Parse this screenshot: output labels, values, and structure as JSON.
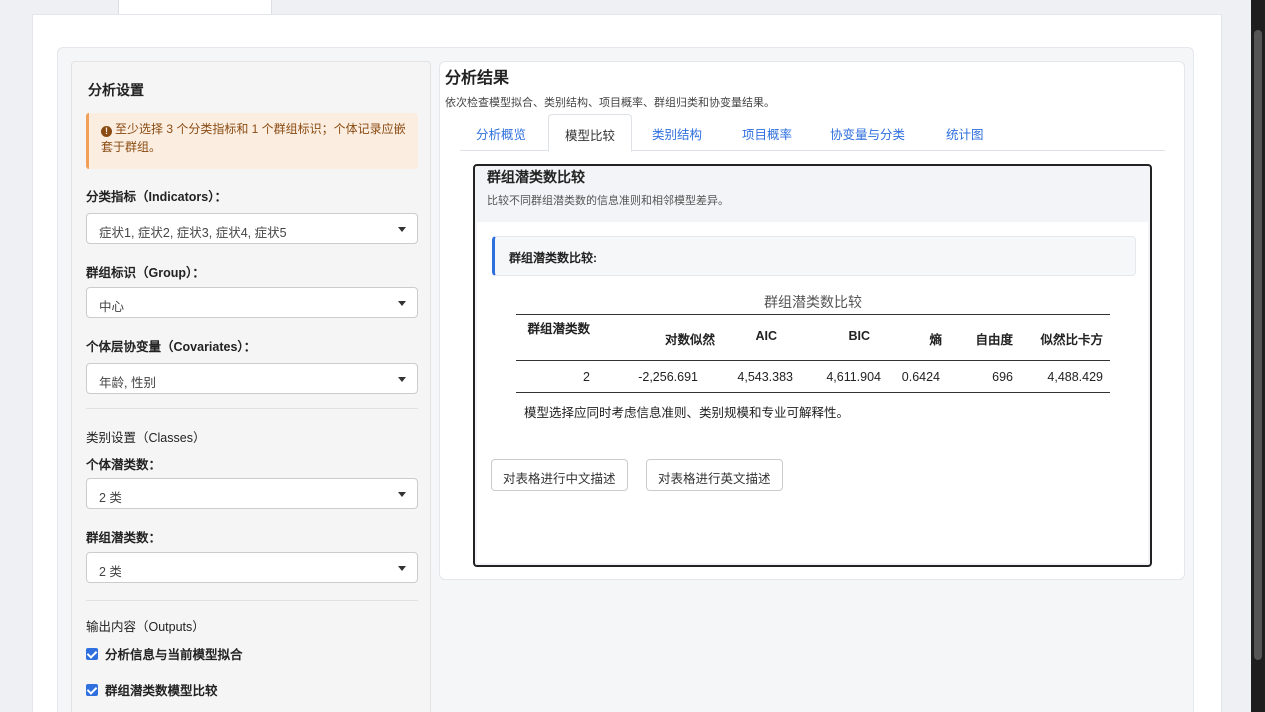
{
  "sidebar": {
    "title": "分析设置",
    "warning": "至少选择 3 个分类指标和 1 个群组标识；个体记录应嵌套于群组。",
    "indicators_label": "分类指标（Indicators）：",
    "indicators_value": "症状1, 症状2, 症状3, 症状4, 症状5",
    "group_label": "群组标识（Group）：",
    "group_value": "中心",
    "covariates_label": "个体层协变量（Covariates）：",
    "covariates_value": "年龄, 性别",
    "classes_heading": "类别设置（Classes）",
    "individual_classes_label": "个体潜类数：",
    "individual_classes_value": "2 类",
    "group_classes_label": "群组潜类数：",
    "group_classes_value": "2 类",
    "outputs_heading": "输出内容（Outputs）",
    "outputs": [
      {
        "label": "分析信息与当前模型拟合",
        "checked": true
      },
      {
        "label": "群组潜类数模型比较",
        "checked": true
      }
    ]
  },
  "main": {
    "title": "分析结果",
    "subtitle": "依次检查模型拟合、类别结构、项目概率、群组归类和协变量结果。",
    "tabs": [
      {
        "label": "分析概览",
        "active": false
      },
      {
        "label": "模型比较",
        "active": true
      },
      {
        "label": "类别结构",
        "active": false
      },
      {
        "label": "项目概率",
        "active": false
      },
      {
        "label": "协变量与分类",
        "active": false
      },
      {
        "label": "统计图",
        "active": false
      }
    ],
    "section_title": "群组潜类数比较",
    "section_subtitle": "比较不同群组潜类数的信息准则和相邻模型差异。",
    "block_label": "群组潜类数比较:",
    "table": {
      "caption": "群组潜类数比较",
      "headers": [
        "群组潜类数",
        "对数似然",
        "AIC",
        "BIC",
        "熵",
        "自由度",
        "似然比卡方"
      ],
      "rows": [
        [
          "2",
          "-2,256.691",
          "4,543.383",
          "4,611.904",
          "0.6424",
          "696",
          "4,488.429"
        ]
      ],
      "note": "模型选择应同时考虑信息准则、类别规模和专业可解释性。"
    },
    "buttons": {
      "describe_cn": "对表格进行中文描述",
      "describe_en": "对表格进行英文描述"
    }
  },
  "colors": {
    "accent": "#2f6fde",
    "warning_bg": "#fbeee1",
    "warning_text": "#8a4b12"
  }
}
